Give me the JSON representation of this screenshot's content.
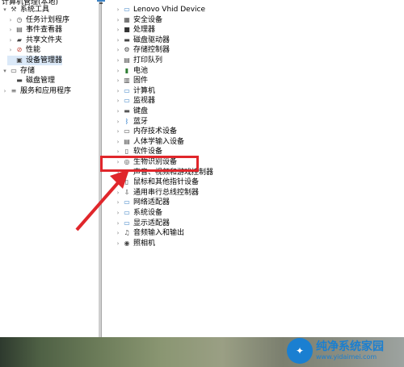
{
  "left_tree": {
    "cut_top": "计算机管理(本地)",
    "items": [
      {
        "label": "系统工具",
        "icon": "tools-icon",
        "chev": "▾",
        "indent": 0
      },
      {
        "label": "任务计划程序",
        "icon": "task-scheduler-icon",
        "chev": "›",
        "indent": 1
      },
      {
        "label": "事件查看器",
        "icon": "event-viewer-icon",
        "chev": "›",
        "indent": 1
      },
      {
        "label": "共享文件夹",
        "icon": "shared-folder-icon",
        "chev": "›",
        "indent": 1
      },
      {
        "label": "性能",
        "icon": "performance-icon",
        "chev": "›",
        "indent": 1
      },
      {
        "label": "设备管理器",
        "icon": "device-manager-icon",
        "chev": "",
        "indent": 1,
        "selected": true
      },
      {
        "label": "存储",
        "icon": "storage-icon",
        "chev": "▾",
        "indent": 0
      },
      {
        "label": "磁盘管理",
        "icon": "disk-management-icon",
        "chev": "",
        "indent": 1
      },
      {
        "label": "服务和应用程序",
        "icon": "services-icon",
        "chev": "›",
        "indent": 0
      }
    ]
  },
  "device_tree": {
    "items": [
      {
        "label": "Lenovo Vhid Device",
        "icon": "monitor-icon"
      },
      {
        "label": "安全设备",
        "icon": "security-device-icon"
      },
      {
        "label": "处理器",
        "icon": "processor-icon"
      },
      {
        "label": "磁盘驱动器",
        "icon": "disk-drive-icon"
      },
      {
        "label": "存储控制器",
        "icon": "storage-controller-icon"
      },
      {
        "label": "打印队列",
        "icon": "printer-icon"
      },
      {
        "label": "电池",
        "icon": "battery-icon"
      },
      {
        "label": "固件",
        "icon": "firmware-icon"
      },
      {
        "label": "计算机",
        "icon": "computer-icon"
      },
      {
        "label": "监视器",
        "icon": "monitor-icon"
      },
      {
        "label": "键盘",
        "icon": "keyboard-icon"
      },
      {
        "label": "蓝牙",
        "icon": "bluetooth-icon"
      },
      {
        "label": "内存技术设备",
        "icon": "memory-icon"
      },
      {
        "label": "人体学输入设备",
        "icon": "hid-icon"
      },
      {
        "label": "软件设备",
        "icon": "software-device-icon"
      },
      {
        "label": "生物识别设备",
        "icon": "biometric-icon"
      },
      {
        "label": "声音、视频和游戏控制器",
        "icon": "audio-icon"
      },
      {
        "label": "鼠标和其他指针设备",
        "icon": "mouse-icon"
      },
      {
        "label": "通用串行总线控制器",
        "icon": "usb-icon"
      },
      {
        "label": "网络适配器",
        "icon": "network-adapter-icon"
      },
      {
        "label": "系统设备",
        "icon": "system-device-icon"
      },
      {
        "label": "显示适配器",
        "icon": "display-adapter-icon"
      },
      {
        "label": "音频输入和输出",
        "icon": "audio-io-icon"
      },
      {
        "label": "照相机",
        "icon": "camera-icon"
      }
    ]
  },
  "watermark": {
    "title": "纯净系统家园",
    "url": "www.yidaimei.com",
    "logo_text": "✦"
  },
  "colors": {
    "annotation_red": "#e0262b",
    "watermark_blue": "#1a7fd1",
    "selection": "#dbe9f8"
  }
}
